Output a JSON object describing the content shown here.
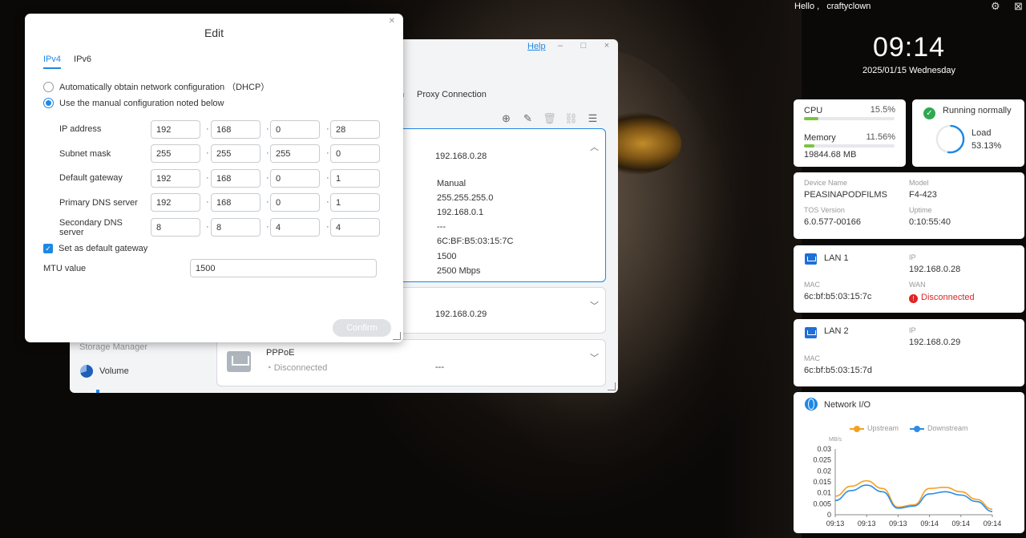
{
  "header": {
    "greeting": "Hello ,",
    "username": "craftyclown",
    "time": "09:14",
    "date": "2025/01/15 Wednesday"
  },
  "app_window": {
    "help": "Help",
    "tab_partial": "n",
    "proxy_tab": "Proxy Connection",
    "lan1_card": {
      "ip_top": "192.168.0.28",
      "mode": "Manual",
      "subnet": "255.255.255.0",
      "gateway": "192.168.0.1",
      "dns": "---",
      "mac": "6C:BF:B5:03:15:7C",
      "mtu": "1500",
      "speed": "2500 Mbps"
    },
    "lan2_card": {
      "ip": "192.168.0.29"
    },
    "pppoe_card": {
      "title": "PPPoE",
      "status": "Disconnected",
      "value": "---"
    },
    "sidebar": {
      "section": "Storage Manager",
      "volume": "Volume"
    }
  },
  "dialog": {
    "title": "Edit",
    "tabs": [
      "IPv4",
      "IPv6"
    ],
    "dhcp_option": "Automatically obtain network configuration （DHCP）",
    "manual_option": "Use the manual configuration noted below",
    "fields": [
      {
        "label": "IP address",
        "octets": [
          "192",
          "168",
          "0",
          "28"
        ]
      },
      {
        "label": "Subnet mask",
        "octets": [
          "255",
          "255",
          "255",
          "0"
        ]
      },
      {
        "label": "Default gateway",
        "octets": [
          "192",
          "168",
          "0",
          "1"
        ]
      },
      {
        "label": "Primary DNS server",
        "octets": [
          "192",
          "168",
          "0",
          "1"
        ]
      },
      {
        "label": "Secondary DNS server",
        "octets": [
          "8",
          "8",
          "4",
          "4"
        ]
      }
    ],
    "default_gateway_check": "Set as default gateway",
    "mtu_label": "MTU value",
    "mtu_value": "1500",
    "confirm": "Confirm"
  },
  "widgets": {
    "resources": {
      "cpu_label": "CPU",
      "cpu_value": "15.5%",
      "cpu_fraction": 0.155,
      "mem_label": "Memory",
      "mem_value": "11.56%",
      "mem_fraction": 0.1156,
      "mem_amount": "19844.68 MB"
    },
    "status": {
      "text": "Running normally",
      "load_label": "Load",
      "load_value": "53.13%",
      "load_fraction": 0.5313
    },
    "device": {
      "name_label": "Device Name",
      "name": "PEASINAPODFILMS",
      "model_label": "Model",
      "model": "F4-423",
      "tos_label": "TOS Version",
      "tos": "6.0.577-00166",
      "uptime_label": "Uptime",
      "uptime": "0:10:55:40"
    },
    "lan1": {
      "title": "LAN 1",
      "ip_label": "IP",
      "ip": "192.168.0.28",
      "mac_label": "MAC",
      "mac": "6c:bf:b5:03:15:7c",
      "wan_label": "WAN",
      "wan": "Disconnected"
    },
    "lan2": {
      "title": "LAN 2",
      "ip_label": "IP",
      "ip": "192.168.0.29",
      "mac_label": "MAC",
      "mac": "6c:bf:b5:03:15:7d"
    },
    "network_io": {
      "title": "Network I/O"
    }
  },
  "colors": {
    "accent": "#1e88e5",
    "upstream": "#f5a020",
    "downstream": "#2b8de8",
    "ok": "#2fa84f",
    "error": "#e02424"
  },
  "chart_data": {
    "type": "line",
    "ylabel": "MB/s",
    "ylim": [
      0,
      0.03
    ],
    "yticks": [
      "0.03",
      "0.025",
      "0.02",
      "0.015",
      "0.01",
      "0.005",
      "0"
    ],
    "categories": [
      "09:13",
      "09:13",
      "09:13",
      "09:14",
      "09:14",
      "09:14"
    ],
    "x": [
      0,
      1,
      2,
      3,
      4,
      5,
      6,
      7,
      8,
      9,
      10
    ],
    "series": [
      {
        "name": "Upstream",
        "color": "#f5a020",
        "values": [
          0.0085,
          0.013,
          0.0155,
          0.012,
          0.0035,
          0.0045,
          0.012,
          0.0125,
          0.0105,
          0.007,
          0.0025
        ]
      },
      {
        "name": "Downstream",
        "color": "#2b8de8",
        "values": [
          0.0065,
          0.011,
          0.0135,
          0.0105,
          0.003,
          0.004,
          0.0095,
          0.0105,
          0.009,
          0.006,
          0.0015
        ]
      }
    ],
    "legend": "top",
    "grid": false
  }
}
